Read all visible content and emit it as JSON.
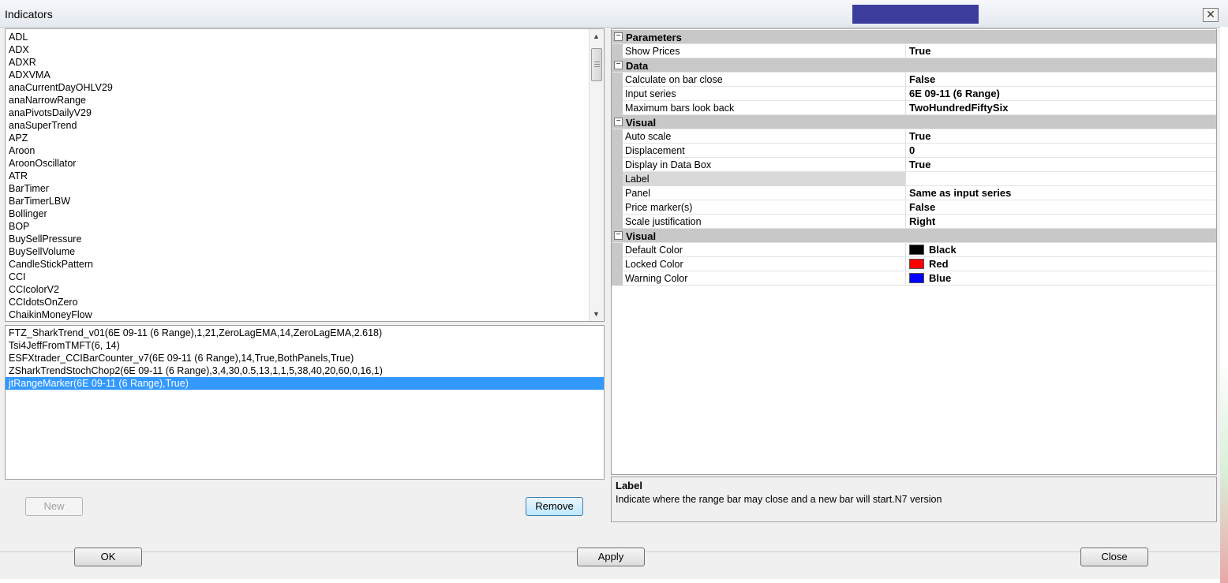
{
  "window": {
    "title": "Indicators",
    "close_glyph": "✕"
  },
  "available": {
    "items": [
      "ADL",
      "ADX",
      "ADXR",
      "ADXVMA",
      "anaCurrentDayOHLV29",
      "anaNarrowRange",
      "anaPivotsDailyV29",
      "anaSuperTrend",
      "APZ",
      "Aroon",
      "AroonOscillator",
      "ATR",
      "BarTimer",
      "BarTimerLBW",
      "Bollinger",
      "BOP",
      "BuySellPressure",
      "BuySellVolume",
      "CandleStickPattern",
      "CCI",
      "CCIcolorV2",
      "CCIdotsOnZero",
      "ChaikinMoneyFlow"
    ]
  },
  "applied": {
    "items": [
      "FTZ_SharkTrend_v01(6E 09-11 (6 Range),1,21,ZeroLagEMA,14,ZeroLagEMA,2.618)",
      "Tsi4JeffFromTMFT(6, 14)",
      "ESFXtrader_CCIBarCounter_v7(6E 09-11 (6 Range),14,True,BothPanels,True)",
      "ZSharkTrendStochChop2(6E 09-11 (6 Range),3,4,30,0.5,13,1,1,5,38,40,20,60,0,16,1)",
      "jtRangeMarker(6E 09-11 (6 Range),True)"
    ],
    "selected_index": 4
  },
  "buttons": {
    "new": "New",
    "remove": "Remove",
    "ok": "OK",
    "apply": "Apply",
    "close": "Close"
  },
  "properties": {
    "categories": [
      {
        "name": "Parameters",
        "rows": [
          {
            "name": "Show Prices",
            "value": "True"
          }
        ]
      },
      {
        "name": "Data",
        "rows": [
          {
            "name": "Calculate on bar close",
            "value": "False"
          },
          {
            "name": "Input series",
            "value": "6E 09-11 (6 Range)"
          },
          {
            "name": "Maximum bars look back",
            "value": "TwoHundredFiftySix"
          }
        ]
      },
      {
        "name": "Visual",
        "rows": [
          {
            "name": "Auto scale",
            "value": "True"
          },
          {
            "name": "Displacement",
            "value": "0"
          },
          {
            "name": "Display in Data Box",
            "value": "True"
          },
          {
            "name": "Label",
            "value": ""
          },
          {
            "name": "Panel",
            "value": "Same as input series"
          },
          {
            "name": "Price marker(s)",
            "value": "False"
          },
          {
            "name": "Scale justification",
            "value": "Right"
          }
        ]
      },
      {
        "name": "Visual",
        "rows": [
          {
            "name": "Default Color",
            "value": "Black",
            "color": "#000000"
          },
          {
            "name": "Locked Color",
            "value": "Red",
            "color": "#ff0000"
          },
          {
            "name": "Warning Color",
            "value": "Blue",
            "color": "#0000ff"
          }
        ]
      }
    ],
    "toggle_glyph": "−"
  },
  "description": {
    "title": "Label",
    "text": "Indicate where the range bar may close and a new bar will start.N7 version"
  },
  "colors": {
    "selection": "#3399ff",
    "category_bg": "#c8c8c8"
  }
}
